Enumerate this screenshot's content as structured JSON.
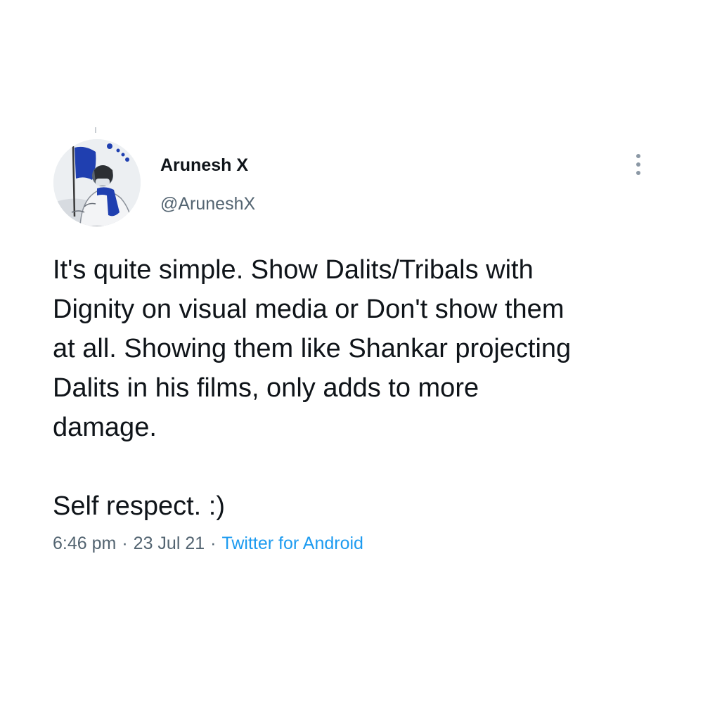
{
  "tweet": {
    "display_name": "Arunesh X",
    "handle": "@AruneshX",
    "avatar": "avatar-illustration",
    "more_icon": "more-vertical-icon",
    "body_paragraphs": [
      "It's quite simple. Show Dalits/Tribals with\nDignity on visual media or Don't show them\nat all. Showing them like Shankar projecting\nDalits in his films, only adds to more\ndamage.",
      "Self respect. :)"
    ],
    "time": "6:46 pm",
    "separator": "·",
    "date": "23 Jul 21",
    "source": "Twitter for Android"
  },
  "colors": {
    "text": "#0f1419",
    "secondary": "#536471",
    "link": "#1d9bf0",
    "background": "#ffffff",
    "avatar_accent": "#1f3fb0"
  }
}
